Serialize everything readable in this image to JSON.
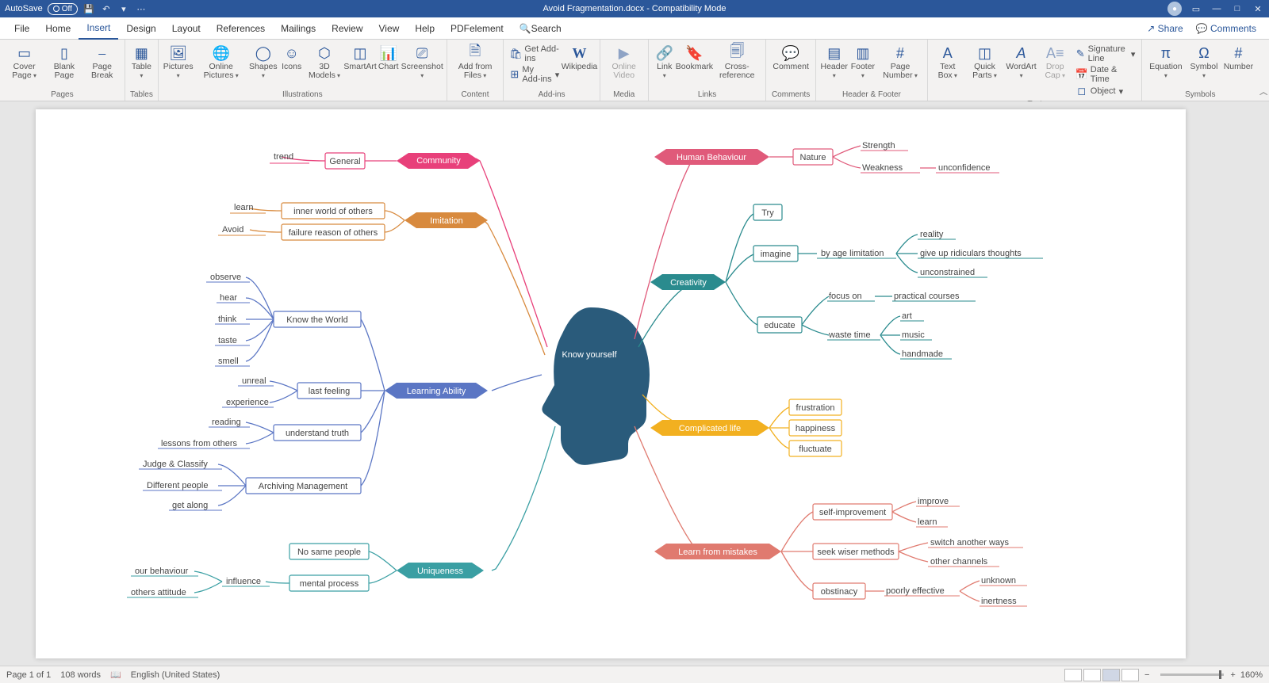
{
  "title": "Avoid Fragmentation.docx  -  Compatibility Mode",
  "autosave": "AutoSave",
  "autosave_state": "Off",
  "menus": [
    "File",
    "Home",
    "Insert",
    "Design",
    "Layout",
    "References",
    "Mailings",
    "Review",
    "View",
    "Help",
    "PDFelement"
  ],
  "active_menu": "Insert",
  "search_label": "Search",
  "share": "Share",
  "comments_btn": "Comments",
  "ribbon": {
    "pages": {
      "label": "Pages",
      "cover": "Cover Page",
      "blank": "Blank Page",
      "break": "Page Break"
    },
    "tables": {
      "label": "Tables",
      "table": "Table"
    },
    "illus": {
      "label": "Illustrations",
      "pictures": "Pictures",
      "online": "Online Pictures",
      "shapes": "Shapes",
      "icons": "Icons",
      "models": "3D Models",
      "smartart": "SmartArt",
      "chart": "Chart",
      "screenshot": "Screenshot"
    },
    "content": {
      "label": "Content",
      "addfrom": "Add from Files"
    },
    "addins": {
      "label": "Add-ins",
      "get": "Get Add-ins",
      "my": "My Add-ins",
      "wiki": "Wikipedia"
    },
    "media": {
      "label": "Media",
      "video": "Online Video"
    },
    "links": {
      "label": "Links",
      "link": "Link",
      "bookmark": "Bookmark",
      "xref": "Cross-reference"
    },
    "comments": {
      "label": "Comments",
      "comment": "Comment"
    },
    "hf": {
      "label": "Header & Footer",
      "header": "Header",
      "footer": "Footer",
      "pagenum": "Page Number"
    },
    "text": {
      "label": "Text",
      "textbox": "Text Box",
      "quick": "Quick Parts",
      "wordart": "WordArt",
      "dropcap": "Drop Cap",
      "sig": "Signature Line",
      "date": "Date & Time",
      "obj": "Object"
    },
    "symbols": {
      "label": "Symbols",
      "eq": "Equation",
      "sym": "Symbol",
      "num": "Number"
    }
  },
  "status": {
    "page": "Page 1 of 1",
    "words": "108 words",
    "lang": "English (United States)",
    "zoom": "160%"
  },
  "center": "Know yourself",
  "branches": {
    "community": {
      "label": "Community",
      "general": "General",
      "trend": "trend"
    },
    "imitation": {
      "label": "Imitation",
      "inner": "inner world of others",
      "learn": "learn",
      "failure": "failure reason of others",
      "avoid": "Avoid"
    },
    "learning": {
      "label": "Learning Ability",
      "know": "Know the World",
      "observe": "observe",
      "hear": "hear",
      "think": "think",
      "taste": "taste",
      "smell": "smell",
      "last": "last feeling",
      "unreal": "unreal",
      "exp": "experience",
      "truth": "understand truth",
      "reading": "reading",
      "lessons": "lessons from others",
      "arch": "Archiving Management",
      "judge": "Judge & Classify",
      "diff": "Different people",
      "along": "get along"
    },
    "unique": {
      "label": "Uniqueness",
      "nosame": "No same people",
      "mental": "mental process",
      "influence": "influence",
      "ourb": "our behaviour",
      "others": "others attitude"
    },
    "human": {
      "label": "Human Behaviour",
      "nature": "Nature",
      "strength": "Strength",
      "weak": "Weakness",
      "unconf": "unconfidence"
    },
    "creativity": {
      "label": "Creativity",
      "try": "Try",
      "imagine": "imagine",
      "byage": "by age limitation",
      "reality": "reality",
      "giveup": "give up ridiculars thoughts",
      "uncon": "unconstrained",
      "educate": "educate",
      "focus": "focus on",
      "practical": "practical courses",
      "waste": "waste time",
      "art": "art",
      "music": "music",
      "handmade": "handmade"
    },
    "complicated": {
      "label": "Complicated life",
      "frust": "frustration",
      "happy": "happiness",
      "fluc": "fluctuate"
    },
    "mistakes": {
      "label": "Learn from mistakes",
      "selfimp": "self-improvement",
      "improve": "improve",
      "learn": "learn",
      "seek": "seek wiser methods",
      "switch": "switch another ways",
      "otherch": "other channels",
      "obst": "obstinacy",
      "poorly": "poorly effective",
      "unknown": "unknown",
      "inert": "inertness"
    }
  },
  "colors": {
    "pink": "#e8407a",
    "orange": "#d88a3e",
    "blue": "#5b76c4",
    "teal": "#3a9fa3",
    "teal2": "#2a8b8e",
    "amber": "#f2b020",
    "salmon": "#e07a6f",
    "rose": "#e05a7a"
  }
}
